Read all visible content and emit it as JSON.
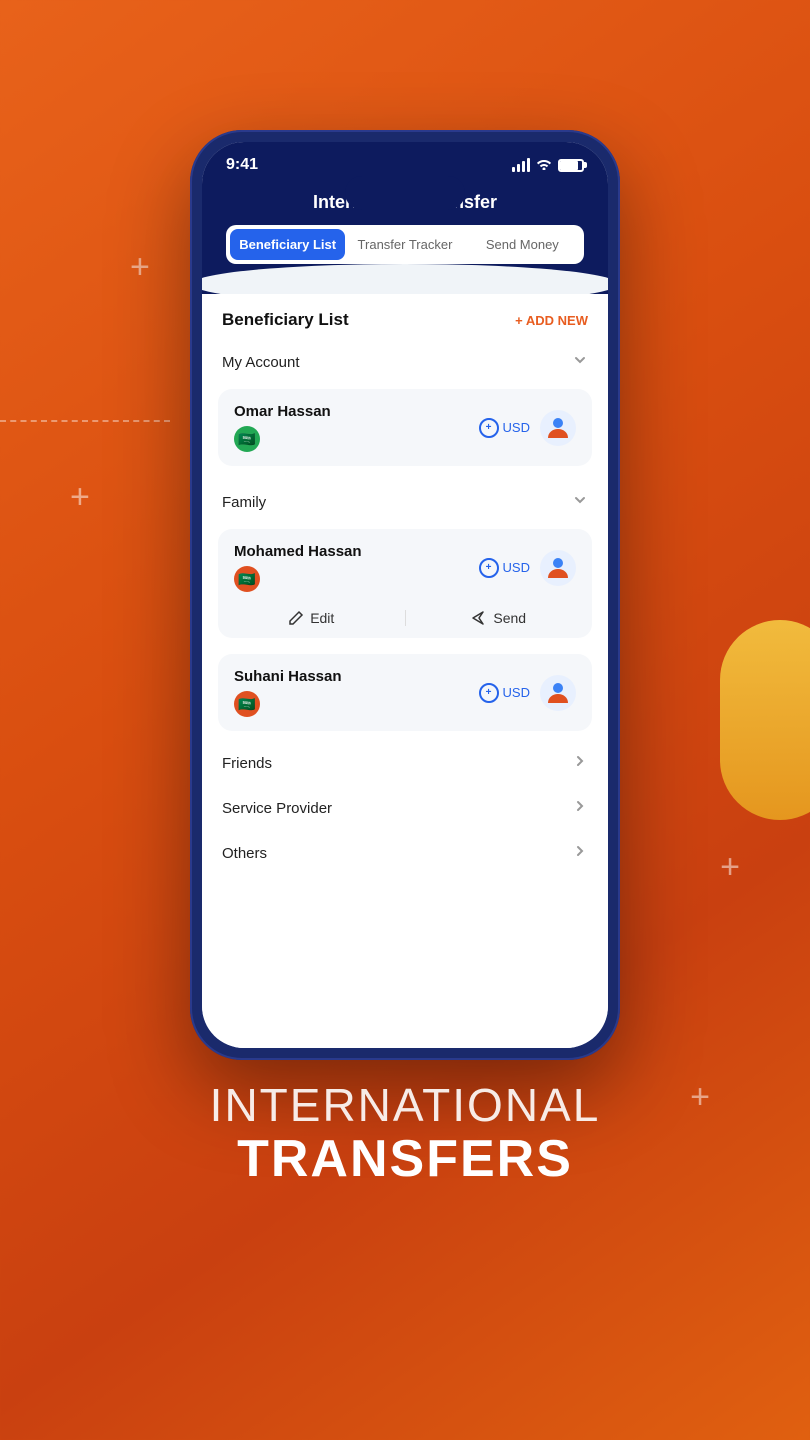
{
  "background": {
    "gradient_from": "#e8621a",
    "gradient_to": "#c94010"
  },
  "status_bar": {
    "time": "9:41",
    "battery": "80"
  },
  "header": {
    "title": "International Transfer"
  },
  "tabs": [
    {
      "label": "Beneficiary List",
      "active": true
    },
    {
      "label": "Transfer Tracker",
      "active": false
    },
    {
      "label": "Send Money",
      "active": false
    }
  ],
  "page_title": "Beneficiary List",
  "add_button": "+ ADD NEW",
  "categories": [
    {
      "name": "My Account",
      "expanded": true,
      "beneficiaries": [
        {
          "name": "Omar Hassan",
          "flag": "🇸🇦",
          "flag_bg": "green",
          "currency": "USD",
          "show_actions": false
        }
      ]
    },
    {
      "name": "Family",
      "expanded": true,
      "beneficiaries": [
        {
          "name": "Mohamed Hassan",
          "flag": "🇸🇦",
          "flag_bg": "multi",
          "currency": "USD",
          "show_actions": true,
          "actions": [
            "Edit",
            "Send"
          ]
        },
        {
          "name": "Suhani Hassan",
          "flag": "🇸🇦",
          "flag_bg": "multi",
          "currency": "USD",
          "show_actions": false
        }
      ]
    },
    {
      "name": "Friends",
      "expanded": false,
      "beneficiaries": []
    },
    {
      "name": "Service Provider",
      "expanded": false,
      "beneficiaries": []
    },
    {
      "name": "Others",
      "expanded": false,
      "beneficiaries": []
    }
  ],
  "bottom_headline_1": "INTERNATIONAL",
  "bottom_headline_2": "TRANSFERS"
}
